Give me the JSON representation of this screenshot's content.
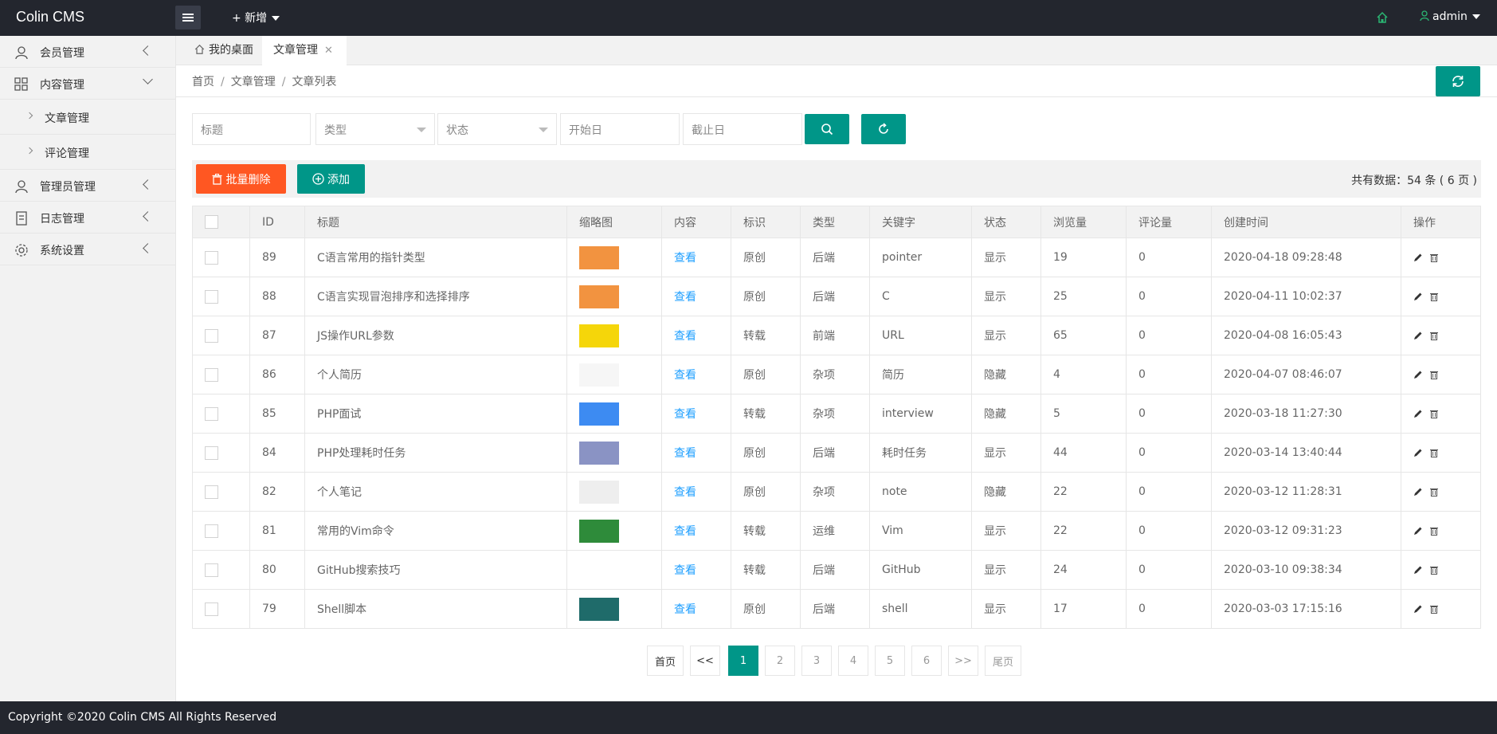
{
  "app": {
    "title": "Colin CMS"
  },
  "topbar": {
    "new_label": "+ 新增",
    "user": "admin"
  },
  "sidebar": {
    "items": [
      {
        "label": "会员管理"
      },
      {
        "label": "内容管理"
      },
      {
        "label": "文章管理"
      },
      {
        "label": "评论管理"
      },
      {
        "label": "管理员管理"
      },
      {
        "label": "日志管理"
      },
      {
        "label": "系统设置"
      }
    ]
  },
  "tabs": [
    {
      "label": "我的桌面"
    },
    {
      "label": "文章管理"
    }
  ],
  "breadcrumb": [
    "首页",
    "文章管理",
    "文章列表"
  ],
  "filters": {
    "title_placeholder": "标题",
    "type_placeholder": "类型",
    "status_placeholder": "状态",
    "start_placeholder": "开始日",
    "end_placeholder": "截止日"
  },
  "toolbar": {
    "batch_delete": "批量删除",
    "add": "添加",
    "count": "共有数据：54 条 ( 6 页 )"
  },
  "table": {
    "headers": [
      "ID",
      "标题",
      "缩略图",
      "内容",
      "标识",
      "类型",
      "关键字",
      "状态",
      "浏览量",
      "评论量",
      "创建时间",
      "操作"
    ],
    "rows": [
      {
        "id": "89",
        "title": "C语言常用的指针类型",
        "thumb_color": "#f29340",
        "content": "查看",
        "tag": "原创",
        "type": "后端",
        "keyword": "pointer",
        "status": "显示",
        "views": "19",
        "comments": "0",
        "created": "2020-04-18 09:28:48"
      },
      {
        "id": "88",
        "title": "C语言实现冒泡排序和选择排序",
        "thumb_color": "#f29340",
        "content": "查看",
        "tag": "原创",
        "type": "后端",
        "keyword": "C",
        "status": "显示",
        "views": "25",
        "comments": "0",
        "created": "2020-04-11 10:02:37"
      },
      {
        "id": "87",
        "title": "JS操作URL参数",
        "thumb_color": "#f5d60a",
        "content": "查看",
        "tag": "转载",
        "type": "前端",
        "keyword": "URL",
        "status": "显示",
        "views": "65",
        "comments": "0",
        "created": "2020-04-08 16:05:43"
      },
      {
        "id": "86",
        "title": "个人简历",
        "thumb_color": "#f6f6f6",
        "content": "查看",
        "tag": "原创",
        "type": "杂项",
        "keyword": "简历",
        "status": "隐藏",
        "views": "4",
        "comments": "0",
        "created": "2020-04-07 08:46:07"
      },
      {
        "id": "85",
        "title": "PHP面试",
        "thumb_color": "#3d8bf2",
        "content": "查看",
        "tag": "转载",
        "type": "杂项",
        "keyword": "interview",
        "status": "隐藏",
        "views": "5",
        "comments": "0",
        "created": "2020-03-18 11:27:30"
      },
      {
        "id": "84",
        "title": "PHP处理耗时任务",
        "thumb_color": "#8a93c4",
        "content": "查看",
        "tag": "原创",
        "type": "后端",
        "keyword": "耗时任务",
        "status": "显示",
        "views": "44",
        "comments": "0",
        "created": "2020-03-14 13:40:44"
      },
      {
        "id": "82",
        "title": "个人笔记",
        "thumb_color": "#eeeeee",
        "content": "查看",
        "tag": "原创",
        "type": "杂项",
        "keyword": "note",
        "status": "隐藏",
        "views": "22",
        "comments": "0",
        "created": "2020-03-12 11:28:31"
      },
      {
        "id": "81",
        "title": "常用的Vim命令",
        "thumb_color": "#2e8b3a",
        "content": "查看",
        "tag": "转载",
        "type": "运维",
        "keyword": "Vim",
        "status": "显示",
        "views": "22",
        "comments": "0",
        "created": "2020-03-12 09:31:23"
      },
      {
        "id": "80",
        "title": "GitHub搜索技巧",
        "thumb_color": "#ffffff",
        "content": "查看",
        "tag": "转载",
        "type": "后端",
        "keyword": "GitHub",
        "status": "显示",
        "views": "24",
        "comments": "0",
        "created": "2020-03-10 09:38:34"
      },
      {
        "id": "79",
        "title": "Shell脚本",
        "thumb_color": "#1f6b6a",
        "content": "查看",
        "tag": "原创",
        "type": "后端",
        "keyword": "shell",
        "status": "显示",
        "views": "17",
        "comments": "0",
        "created": "2020-03-03 17:15:16"
      }
    ]
  },
  "pagination": {
    "first": "首页",
    "prev": "<<",
    "pages": [
      "1",
      "2",
      "3",
      "4",
      "5",
      "6"
    ],
    "current": "1",
    "next": ">>",
    "last": "尾页"
  },
  "footer": {
    "copyright": "Copyright ©2020 Colin CMS All Rights Reserved"
  },
  "colors": {
    "accent": "#009688",
    "danger": "#ff5722",
    "link": "#1e9fff",
    "header_bg": "#23262e"
  }
}
